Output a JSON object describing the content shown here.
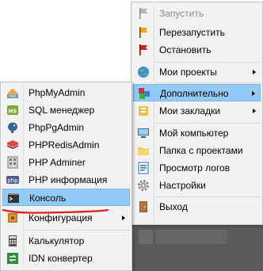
{
  "main_menu": {
    "items": [
      {
        "label": "Запустить",
        "icon": "flag-gray-icon",
        "disabled": true
      },
      {
        "label": "Перезапустить",
        "icon": "flag-orange-icon"
      },
      {
        "label": "Остановить",
        "icon": "flag-red-icon"
      },
      {
        "label": "Мои проекты",
        "icon": "globe-icon",
        "submenu": true
      },
      {
        "label": "Дополнительно",
        "icon": "blocks-icon",
        "submenu": true,
        "highlighted": true
      },
      {
        "label": "Мои закладки",
        "icon": "bookmarks-icon",
        "submenu": true
      },
      {
        "label": "Мой компьютер",
        "icon": "computer-icon"
      },
      {
        "label": "Папка с проектами",
        "icon": "folder-icon"
      },
      {
        "label": "Просмотр логов",
        "icon": "log-icon"
      },
      {
        "label": "Настройки",
        "icon": "gear-icon"
      },
      {
        "label": "Выход",
        "icon": "exit-icon"
      }
    ]
  },
  "sub_menu": {
    "items": [
      {
        "label": "PhpMyAdmin",
        "icon": "phpmyadmin-icon"
      },
      {
        "label": "SQL менеджер",
        "icon": "hs-icon"
      },
      {
        "label": "PhpPgAdmin",
        "icon": "elephant-icon"
      },
      {
        "label": "PHPRedisAdmin",
        "icon": "redis-icon"
      },
      {
        "label": "PHP Adminer",
        "icon": "adminer-icon"
      },
      {
        "label": "PHP информация",
        "icon": "php-icon"
      },
      {
        "label": "Консоль",
        "icon": "console-icon",
        "highlighted": true
      },
      {
        "label": "Конфигурация",
        "icon": "config-icon",
        "submenu": true
      },
      {
        "label": "Калькулятор",
        "icon": "calculator-icon"
      },
      {
        "label": "IDN конвертер",
        "icon": "idn-icon"
      }
    ]
  },
  "colors": {
    "highlight": "#91c9f7",
    "underline": "#e0201a"
  }
}
